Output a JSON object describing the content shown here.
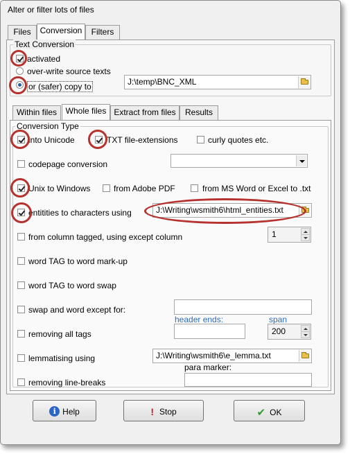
{
  "window": {
    "title": "Alter or filter lots of files"
  },
  "main_tabs": [
    {
      "label": "Files",
      "active": false
    },
    {
      "label": "Conversion",
      "active": true
    },
    {
      "label": "Filters",
      "active": false
    }
  ],
  "text_conversion": {
    "title": "Text Conversion",
    "activated": {
      "label": "activated",
      "checked": true
    },
    "overwrite": {
      "label": "over-write source texts",
      "selected": false
    },
    "copy_to": {
      "label": "or (safer) copy to",
      "selected": true
    },
    "copy_path": "J:\\temp\\BNC_XML"
  },
  "sub_tabs": [
    {
      "label": "Within files",
      "active": false
    },
    {
      "label": "Whole files",
      "active": true
    },
    {
      "label": "Extract from files",
      "active": false
    },
    {
      "label": "Results",
      "active": false
    }
  ],
  "conversion_type": {
    "title": "Conversion Type",
    "into_unicode": {
      "label": "into Unicode",
      "checked": true
    },
    "txt_ext": {
      "label": "TXT file-extensions",
      "checked": true
    },
    "curly_quotes": {
      "label": "curly quotes etc.",
      "checked": false
    },
    "codepage": {
      "label": "codepage conversion",
      "checked": false,
      "value": ""
    },
    "unix_to_windows": {
      "label": "Unix to Windows",
      "checked": true
    },
    "from_adobe": {
      "label": "from Adobe PDF",
      "checked": false
    },
    "from_msword": {
      "label": "from MS Word or Excel to .txt",
      "checked": false
    },
    "entities": {
      "label": "entitities to characters using",
      "checked": true,
      "path": "J:\\Writing\\wsmith6\\html_entities.txt"
    },
    "column_tagged": {
      "label": "from column tagged, using  except column",
      "checked": false,
      "value": "1"
    },
    "word_tag_markup": {
      "label": "word  TAG to word mark-up",
      "checked": false
    },
    "word_tag_swap": {
      "label": "word  TAG to word swap",
      "checked": false
    },
    "swap_word": {
      "label": "swap  and word except for:",
      "checked": false,
      "value": ""
    },
    "header_ends_label": "header ends:",
    "header_ends_value": "",
    "span_label": "span",
    "span_value": "200",
    "removing_tags": {
      "label": "removing all tags",
      "checked": false
    },
    "lemmatising": {
      "label": "lemmatising using",
      "checked": false,
      "path": "J:\\Writing\\wsmith6\\e_lemma.txt"
    },
    "para_marker_label": "para marker:",
    "para_marker_value": "",
    "removing_linebreaks": {
      "label": "removing line-breaks",
      "checked": false
    }
  },
  "buttons": {
    "help": "Help",
    "stop": "Stop",
    "ok": "OK"
  },
  "colors": {
    "annotation": "#b5322e",
    "accent_label": "#2e6bbd"
  }
}
